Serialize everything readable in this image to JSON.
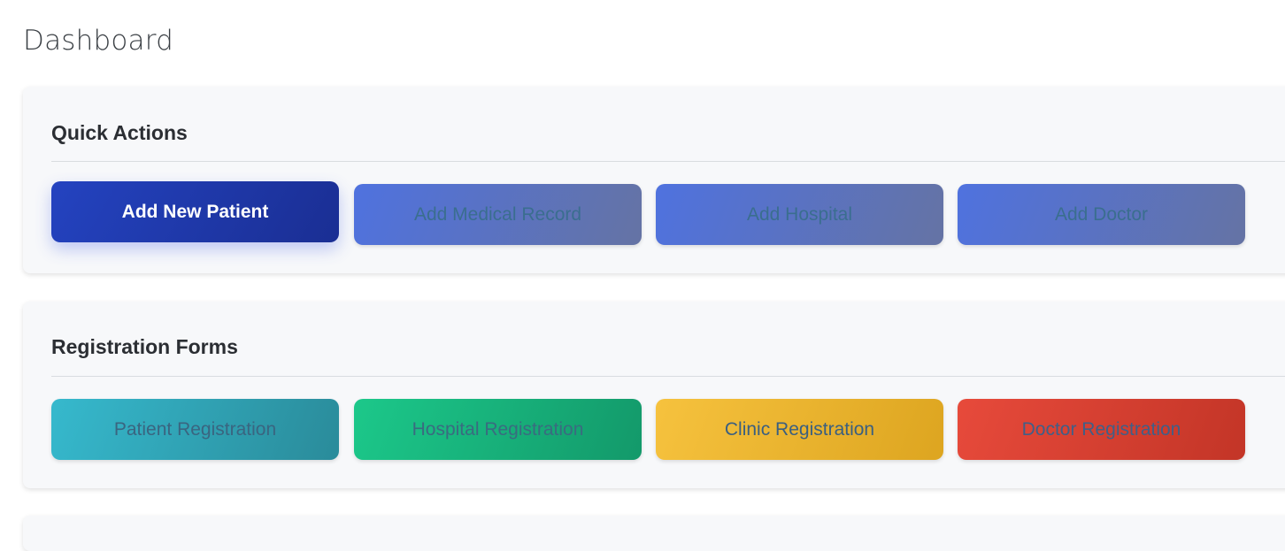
{
  "page": {
    "title": "Dashboard"
  },
  "quick_actions": {
    "title": "Quick Actions",
    "buttons": [
      {
        "label": "Add New Patient",
        "color": "#2443c0"
      },
      {
        "label": "Add Medical Record",
        "color": "#4f72df"
      },
      {
        "label": "Add Hospital",
        "color": "#4f72df"
      },
      {
        "label": "Add Doctor",
        "color": "#4f72df"
      }
    ]
  },
  "registration_forms": {
    "title": "Registration Forms",
    "buttons": [
      {
        "label": "Patient Registration",
        "color": "#36b9cd"
      },
      {
        "label": "Hospital Registration",
        "color": "#1cc88a"
      },
      {
        "label": "Clinic Registration",
        "color": "#f6c23e"
      },
      {
        "label": "Doctor Registration",
        "color": "#e74a3b"
      }
    ]
  }
}
